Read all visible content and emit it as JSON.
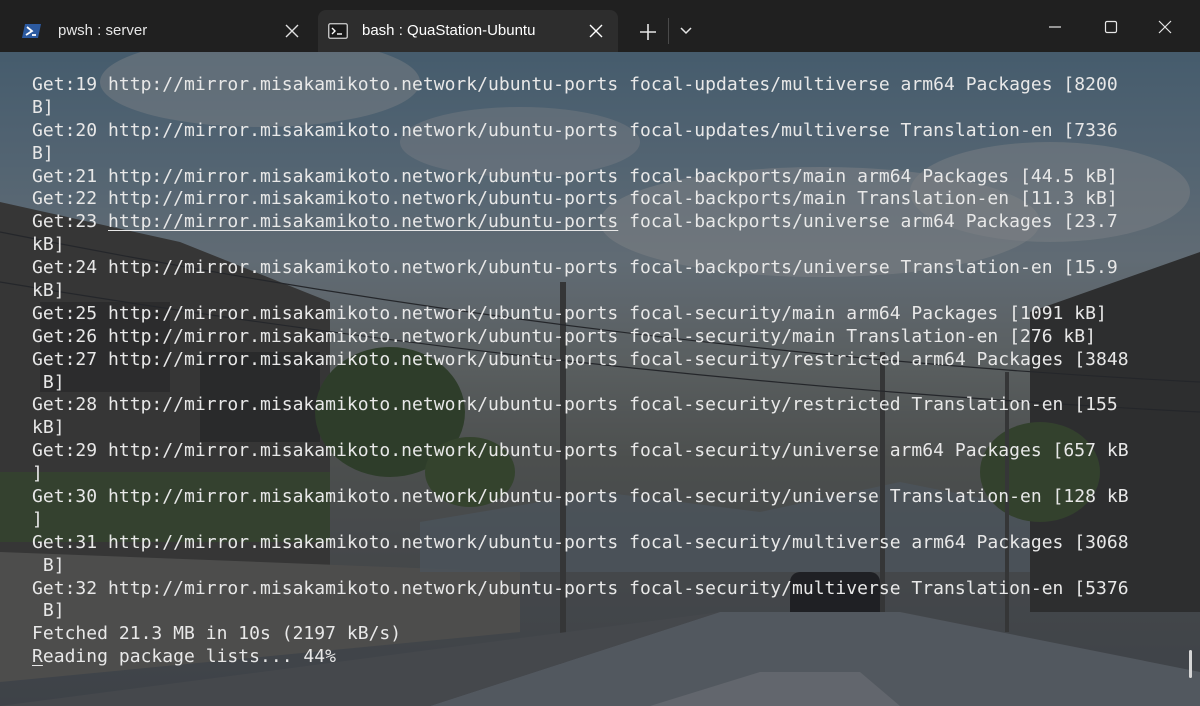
{
  "tabs": [
    {
      "label": "pwsh : server",
      "icon": "powershell-icon",
      "active": false
    },
    {
      "label": "bash : QuaStation-Ubuntu",
      "icon": "terminal-icon",
      "active": true
    }
  ],
  "titlebar": {
    "new_tab_icon": "plus-icon",
    "dropdown_icon": "chevron-down-icon",
    "window_controls": [
      "minimize-icon",
      "maximize-icon",
      "close-icon"
    ]
  },
  "terminal": {
    "lines": [
      {
        "prefix": "Get:19 ",
        "url": "http://mirror.misakamikoto.network/ubuntu-ports",
        "rest": " focal-updates/multiverse arm64 Packages [8200"
      },
      {
        "text": "B]"
      },
      {
        "prefix": "Get:20 ",
        "url": "http://mirror.misakamikoto.network/ubuntu-ports",
        "rest": " focal-updates/multiverse Translation-en [7336"
      },
      {
        "text": "B]"
      },
      {
        "prefix": "Get:21 ",
        "url": "http://mirror.misakamikoto.network/ubuntu-ports",
        "rest": " focal-backports/main arm64 Packages [44.5 kB]"
      },
      {
        "prefix": "Get:22 ",
        "url": "http://mirror.misakamikoto.network/ubuntu-ports",
        "rest": " focal-backports/main Translation-en [11.3 kB]"
      },
      {
        "prefix": "Get:23 ",
        "url": "http://mirror.misakamikoto.network/ubuntu-ports",
        "rest": " focal-backports/universe arm64 Packages [23.7",
        "hover": true
      },
      {
        "text": "kB]"
      },
      {
        "prefix": "Get:24 ",
        "url": "http://mirror.misakamikoto.network/ubuntu-ports",
        "rest": " focal-backports/universe Translation-en [15.9"
      },
      {
        "text": "kB]"
      },
      {
        "prefix": "Get:25 ",
        "url": "http://mirror.misakamikoto.network/ubuntu-ports",
        "rest": " focal-security/main arm64 Packages [1091 kB]"
      },
      {
        "prefix": "Get:26 ",
        "url": "http://mirror.misakamikoto.network/ubuntu-ports",
        "rest": " focal-security/main Translation-en [276 kB]"
      },
      {
        "prefix": "Get:27 ",
        "url": "http://mirror.misakamikoto.network/ubuntu-ports",
        "rest": " focal-security/restricted arm64 Packages [3848"
      },
      {
        "text": " B]"
      },
      {
        "prefix": "Get:28 ",
        "url": "http://mirror.misakamikoto.network/ubuntu-ports",
        "rest": " focal-security/restricted Translation-en [155"
      },
      {
        "text": "kB]"
      },
      {
        "prefix": "Get:29 ",
        "url": "http://mirror.misakamikoto.network/ubuntu-ports",
        "rest": " focal-security/universe arm64 Packages [657 kB"
      },
      {
        "text": "]"
      },
      {
        "prefix": "Get:30 ",
        "url": "http://mirror.misakamikoto.network/ubuntu-ports",
        "rest": " focal-security/universe Translation-en [128 kB"
      },
      {
        "text": "]"
      },
      {
        "prefix": "Get:31 ",
        "url": "http://mirror.misakamikoto.network/ubuntu-ports",
        "rest": " focal-security/multiverse arm64 Packages [3068"
      },
      {
        "text": " B]"
      },
      {
        "prefix": "Get:32 ",
        "url": "http://mirror.misakamikoto.network/ubuntu-ports",
        "rest": " focal-security/multiverse Translation-en [5376"
      },
      {
        "text": " B]"
      },
      {
        "text": "Fetched 21.3 MB in 10s (2197 kB/s)"
      },
      {
        "text": "Reading package lists... 44%",
        "cursor": true
      }
    ]
  }
}
